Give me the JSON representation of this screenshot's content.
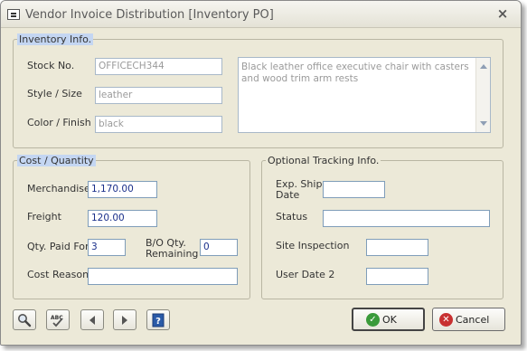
{
  "window": {
    "title": "Vendor Invoice Distribution [Inventory PO]",
    "close_symbol": "×"
  },
  "inventory": {
    "legend": "Inventory Info.",
    "stock_label": "Stock No.",
    "stock_value": "OFFICECH344",
    "style_label": "Style / Size",
    "style_value": "leather",
    "color_label": "Color / Finish",
    "color_value": "black",
    "description": "Black leather office executive chair with casters and wood trim arm rests"
  },
  "cost": {
    "legend": "Cost / Quantity",
    "merchandise_label": "Merchandise",
    "merchandise_value": "1,170.00",
    "freight_label": "Freight",
    "freight_value": "120.00",
    "qty_label": "Qty. Paid For",
    "qty_value": "3",
    "bo_label_1": "B/O Qty.",
    "bo_label_2": "Remaining",
    "bo_value": "0",
    "reason_label": "Cost Reason",
    "reason_value": ""
  },
  "tracking": {
    "legend": "Optional Tracking Info.",
    "ship_label_1": "Exp. Ship",
    "ship_label_2": "Date",
    "ship_value": "",
    "status_label": "Status",
    "status_value": "",
    "site_label": "Site Inspection",
    "site_value": "",
    "user_date_label": "User Date 2",
    "user_date_value": ""
  },
  "toolbar": {
    "search_icon": "magnifier-icon",
    "spell_icon": "spellcheck-icon",
    "spell_text": "ABC",
    "prev_icon": "triangle-left-icon",
    "next_icon": "triangle-right-icon",
    "help_icon": "help-book-icon",
    "help_text": "?"
  },
  "buttons": {
    "ok_label": "OK",
    "ok_icon_symbol": "✓",
    "cancel_label": "Cancel",
    "cancel_icon_symbol": "✕"
  },
  "colors": {
    "window_bg": "#ece9d8",
    "legend_highlight": "#c4d6f2",
    "value_text": "#1a2f8a",
    "ok_green": "#3a9a3a",
    "cancel_red": "#c83030",
    "help_blue": "#2a5aa8"
  }
}
